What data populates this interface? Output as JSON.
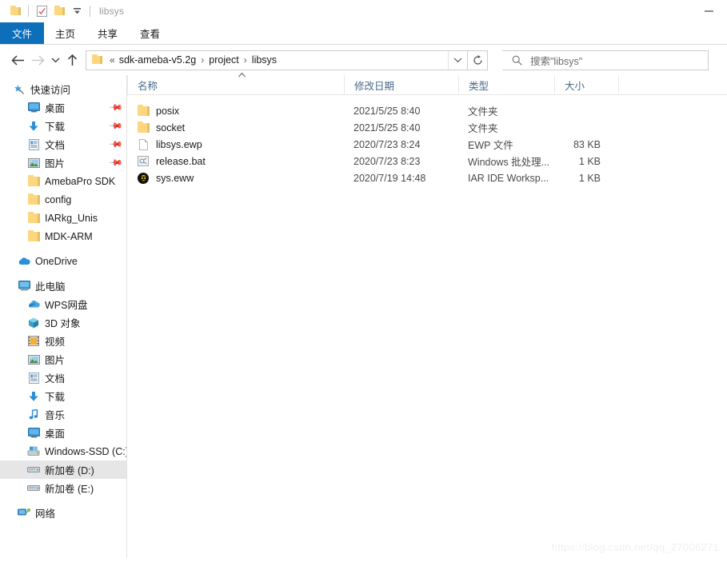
{
  "window": {
    "title": "libsys",
    "quick_access_toolbar": [
      {
        "name": "folder-icon",
        "label": "属性"
      },
      {
        "name": "properties-icon",
        "label": "属性"
      },
      {
        "name": "new-folder-icon",
        "label": "新建文件夹"
      },
      {
        "name": "chevron-down-icon",
        "label": "自定义快速访问工具栏"
      }
    ],
    "controls": {
      "minimize": "最小化"
    }
  },
  "ribbon": {
    "tabs": [
      {
        "label": "文件",
        "active": true
      },
      {
        "label": "主页",
        "active": false
      },
      {
        "label": "共享",
        "active": false
      },
      {
        "label": "查看",
        "active": false
      }
    ]
  },
  "nav": {
    "back": "←",
    "forward": "→",
    "recent": "⌄",
    "up": "↑",
    "breadcrumb": {
      "prefix": "«",
      "items": [
        "sdk-ameba-v5.2g",
        "project",
        "libsys"
      ],
      "separator": "›"
    },
    "address_dropdown": "⌄",
    "refresh": "↻"
  },
  "search": {
    "placeholder": "搜索\"libsys\"",
    "icon": "search-icon"
  },
  "sidebar": {
    "groups": [
      {
        "header": {
          "label": "快速访问",
          "icon": "star-pin-icon"
        },
        "items": [
          {
            "label": "桌面",
            "icon": "desktop-icon",
            "pinned": true
          },
          {
            "label": "下载",
            "icon": "download-icon",
            "pinned": true
          },
          {
            "label": "文档",
            "icon": "documents-icon",
            "pinned": true
          },
          {
            "label": "图片",
            "icon": "pictures-icon",
            "pinned": true
          },
          {
            "label": "AmebaPro SDK",
            "icon": "folder-icon",
            "pinned": false
          },
          {
            "label": "config",
            "icon": "folder-icon",
            "pinned": false
          },
          {
            "label": "IARkg_Unis",
            "icon": "folder-icon",
            "pinned": false
          },
          {
            "label": "MDK-ARM",
            "icon": "folder-icon",
            "pinned": false
          }
        ]
      },
      {
        "header": {
          "label": "OneDrive",
          "icon": "onedrive-icon"
        },
        "items": []
      },
      {
        "header": {
          "label": "此电脑",
          "icon": "this-pc-icon"
        },
        "items": [
          {
            "label": "WPS网盘",
            "icon": "wps-cloud-icon",
            "selected": false
          },
          {
            "label": "3D 对象",
            "icon": "3d-objects-icon",
            "selected": false
          },
          {
            "label": "视频",
            "icon": "videos-icon",
            "selected": false
          },
          {
            "label": "图片",
            "icon": "pictures-icon",
            "selected": false
          },
          {
            "label": "文档",
            "icon": "documents-icon",
            "selected": false
          },
          {
            "label": "下载",
            "icon": "download-icon",
            "selected": false
          },
          {
            "label": "音乐",
            "icon": "music-icon",
            "selected": false
          },
          {
            "label": "桌面",
            "icon": "desktop-icon",
            "selected": false
          },
          {
            "label": "Windows-SSD (C:)",
            "icon": "system-drive-icon",
            "selected": false
          },
          {
            "label": "新加卷 (D:)",
            "icon": "drive-icon",
            "selected": true
          },
          {
            "label": "新加卷 (E:)",
            "icon": "drive-icon",
            "selected": false
          }
        ]
      },
      {
        "header": {
          "label": "网络",
          "icon": "network-icon"
        },
        "items": []
      }
    ]
  },
  "filelist": {
    "columns": [
      {
        "label": "名称",
        "sorted": "asc"
      },
      {
        "label": "修改日期",
        "sorted": ""
      },
      {
        "label": "类型",
        "sorted": ""
      },
      {
        "label": "大小",
        "sorted": ""
      }
    ],
    "rows": [
      {
        "name": "posix",
        "icon": "folder-icon",
        "date": "2021/5/25 8:40",
        "type": "文件夹",
        "size": ""
      },
      {
        "name": "socket",
        "icon": "folder-icon",
        "date": "2021/5/25 8:40",
        "type": "文件夹",
        "size": ""
      },
      {
        "name": "libsys.ewp",
        "icon": "document-icon",
        "date": "2020/7/23 8:24",
        "type": "EWP 文件",
        "size": "83 KB"
      },
      {
        "name": "release.bat",
        "icon": "batch-file-icon",
        "date": "2020/7/23 8:23",
        "type": "Windows 批处理...",
        "size": "1 KB"
      },
      {
        "name": "sys.eww",
        "icon": "iar-workspace-icon",
        "date": "2020/7/19 14:48",
        "type": "IAR IDE Worksp...",
        "size": "1 KB"
      }
    ]
  },
  "watermark": {
    "text": "https://blog.csdn.net/qq_27006271"
  },
  "colors": {
    "accent": "#0d6fba",
    "folder": "#fcd77f",
    "header_text": "#4a6b8a",
    "selection": "#e6e6e6"
  }
}
